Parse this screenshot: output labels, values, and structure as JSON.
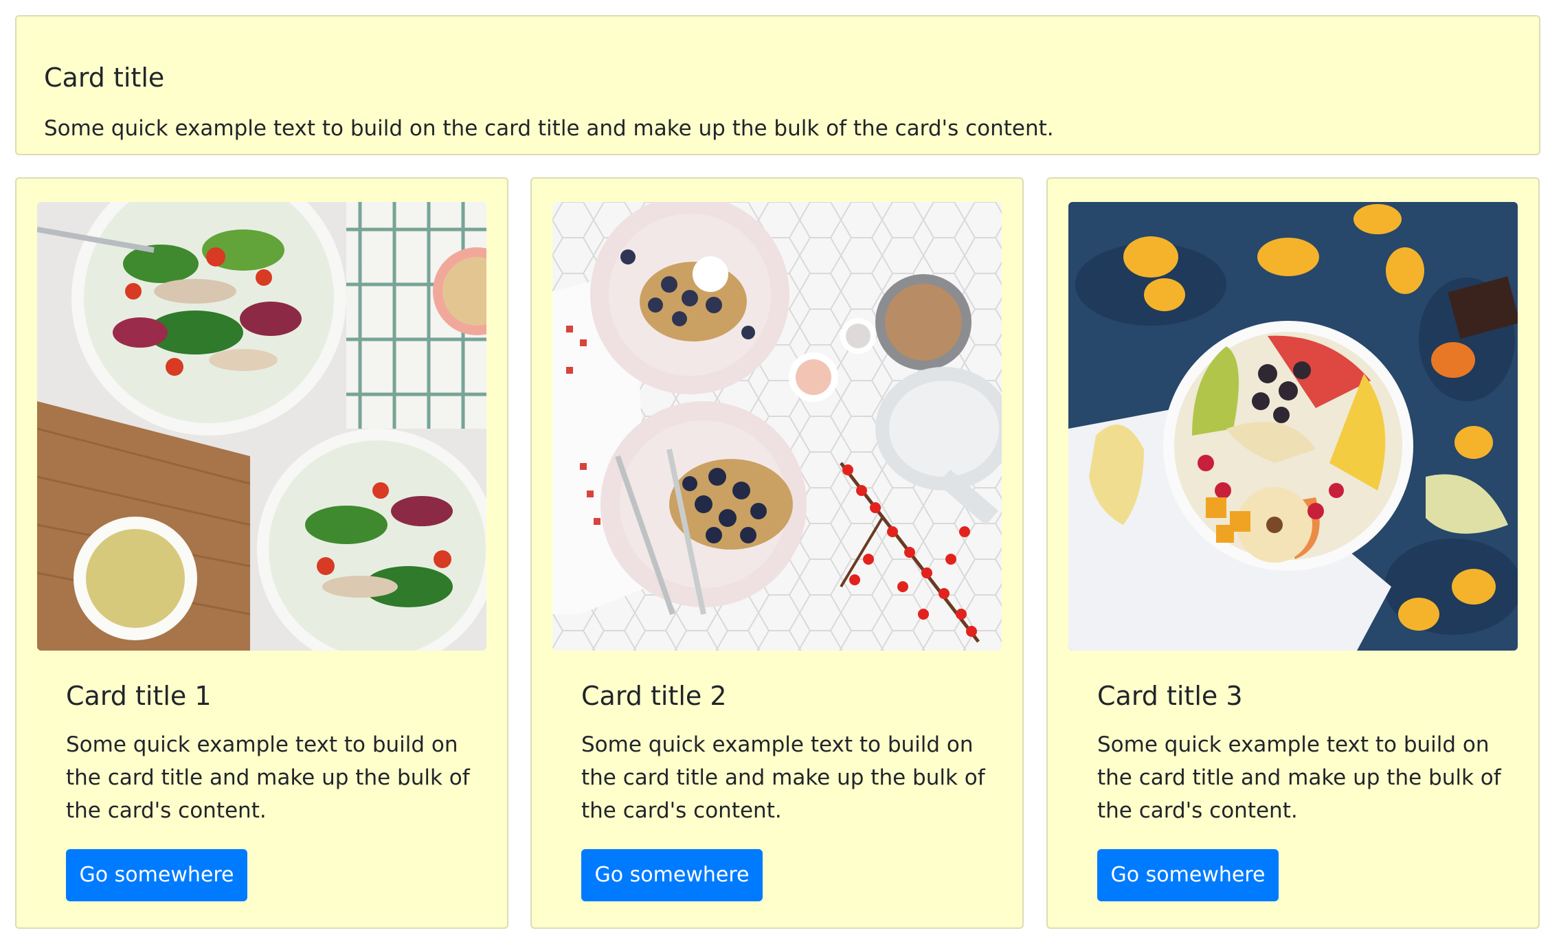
{
  "top_card": {
    "title": "Card title",
    "text": "Some quick example text to build on the card title and make up the bulk of the card's content."
  },
  "cards": [
    {
      "image": "salad-bowls-photo",
      "title": "Card title 1",
      "text": "Some quick example text to build on the card title and make up the bulk of the card's content.",
      "button": "Go somewhere"
    },
    {
      "image": "berry-waffles-photo",
      "title": "Card title 2",
      "text": "Some quick example text to build on the card title and make up the bulk of the card's content.",
      "button": "Go somewhere"
    },
    {
      "image": "fruit-platter-photo",
      "title": "Card title 3",
      "text": "Some quick example text to build on the card title and make up the bulk of the card's content.",
      "button": "Go somewhere"
    }
  ],
  "colors": {
    "card_background": "#ffffcc",
    "card_border": "#dcdcb4",
    "button_primary": "#007bff",
    "text": "#212529"
  }
}
